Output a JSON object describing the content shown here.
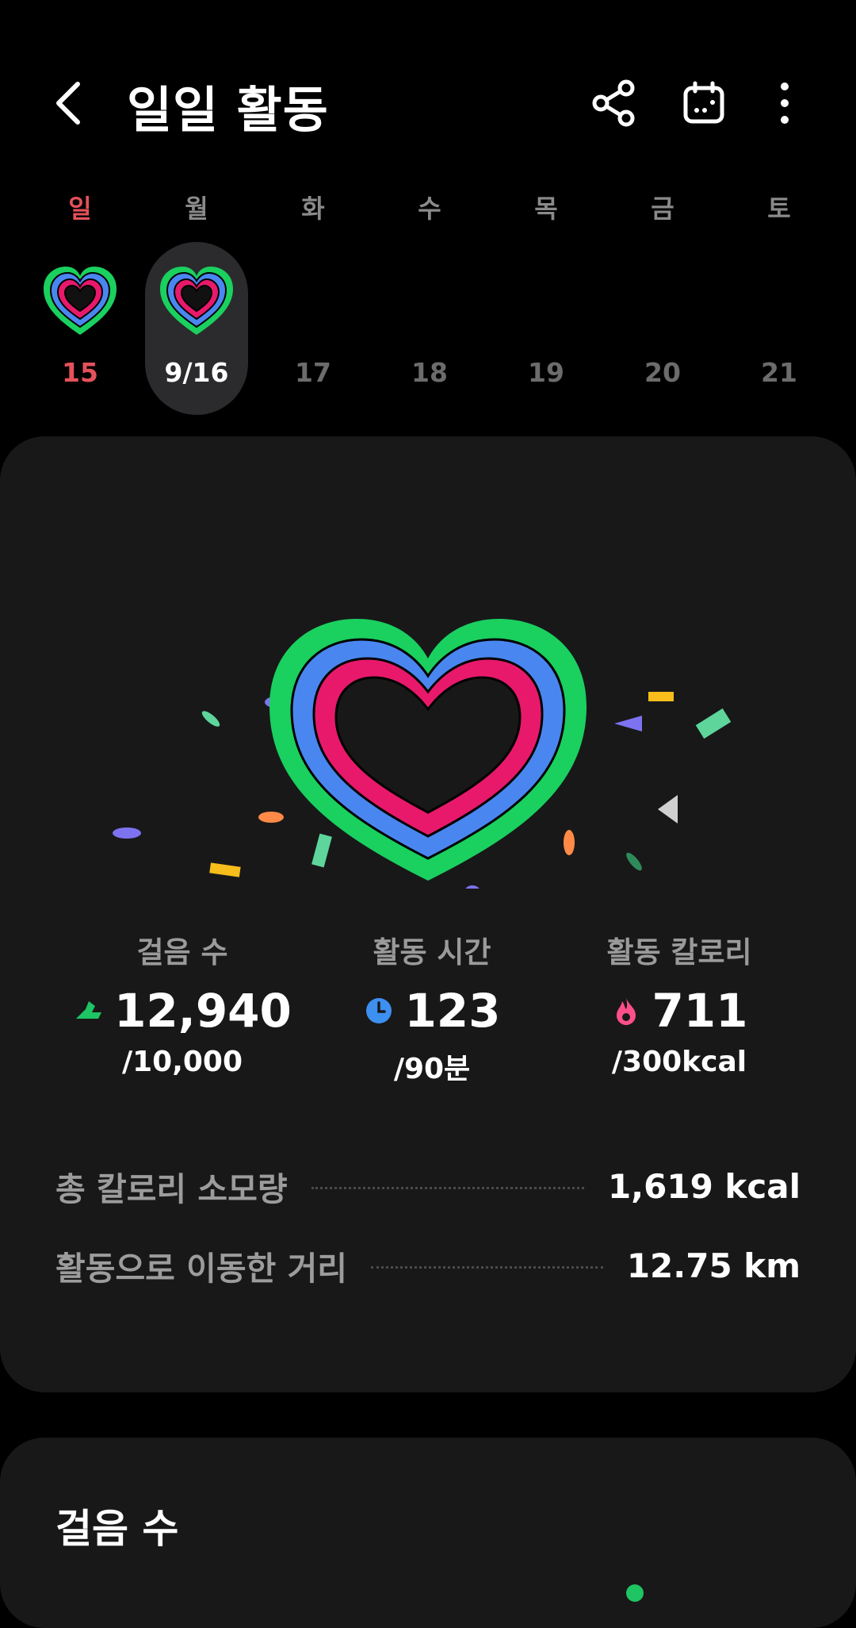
{
  "header": {
    "title": "일일 활동"
  },
  "week": [
    {
      "weekday": "일",
      "date": "15",
      "type": "sun",
      "completed": true
    },
    {
      "weekday": "월",
      "date": "9/16",
      "type": "sel",
      "completed": true
    },
    {
      "weekday": "화",
      "date": "17",
      "type": "",
      "completed": false
    },
    {
      "weekday": "수",
      "date": "18",
      "type": "",
      "completed": false
    },
    {
      "weekday": "목",
      "date": "19",
      "type": "",
      "completed": false
    },
    {
      "weekday": "금",
      "date": "20",
      "type": "",
      "completed": false
    },
    {
      "weekday": "토",
      "date": "21",
      "type": "",
      "completed": false
    }
  ],
  "stats": [
    {
      "label": "걸음 수",
      "value": "12,940",
      "goal": "/10,000",
      "icon": "shoe-icon",
      "color": "#1fc463"
    },
    {
      "label": "활동 시간",
      "value": "123",
      "goal": "/90분",
      "icon": "clock-icon",
      "color": "#3d8ff0"
    },
    {
      "label": "활동 칼로리",
      "value": "711",
      "goal": "/300kcal",
      "icon": "flame-icon",
      "color": "#ff4f8b"
    }
  ],
  "summary": {
    "total_calories": {
      "label": "총 칼로리 소모량",
      "value": "1,619 kcal"
    },
    "distance": {
      "label": "활동으로 이동한 거리",
      "value": "12.75 km"
    }
  },
  "steps_card": {
    "title": "걸음 수"
  },
  "colors": {
    "ring_green": "#1ad05f",
    "ring_blue": "#4a86f0",
    "ring_pink": "#e8196b",
    "sunday": "#e5515b"
  }
}
